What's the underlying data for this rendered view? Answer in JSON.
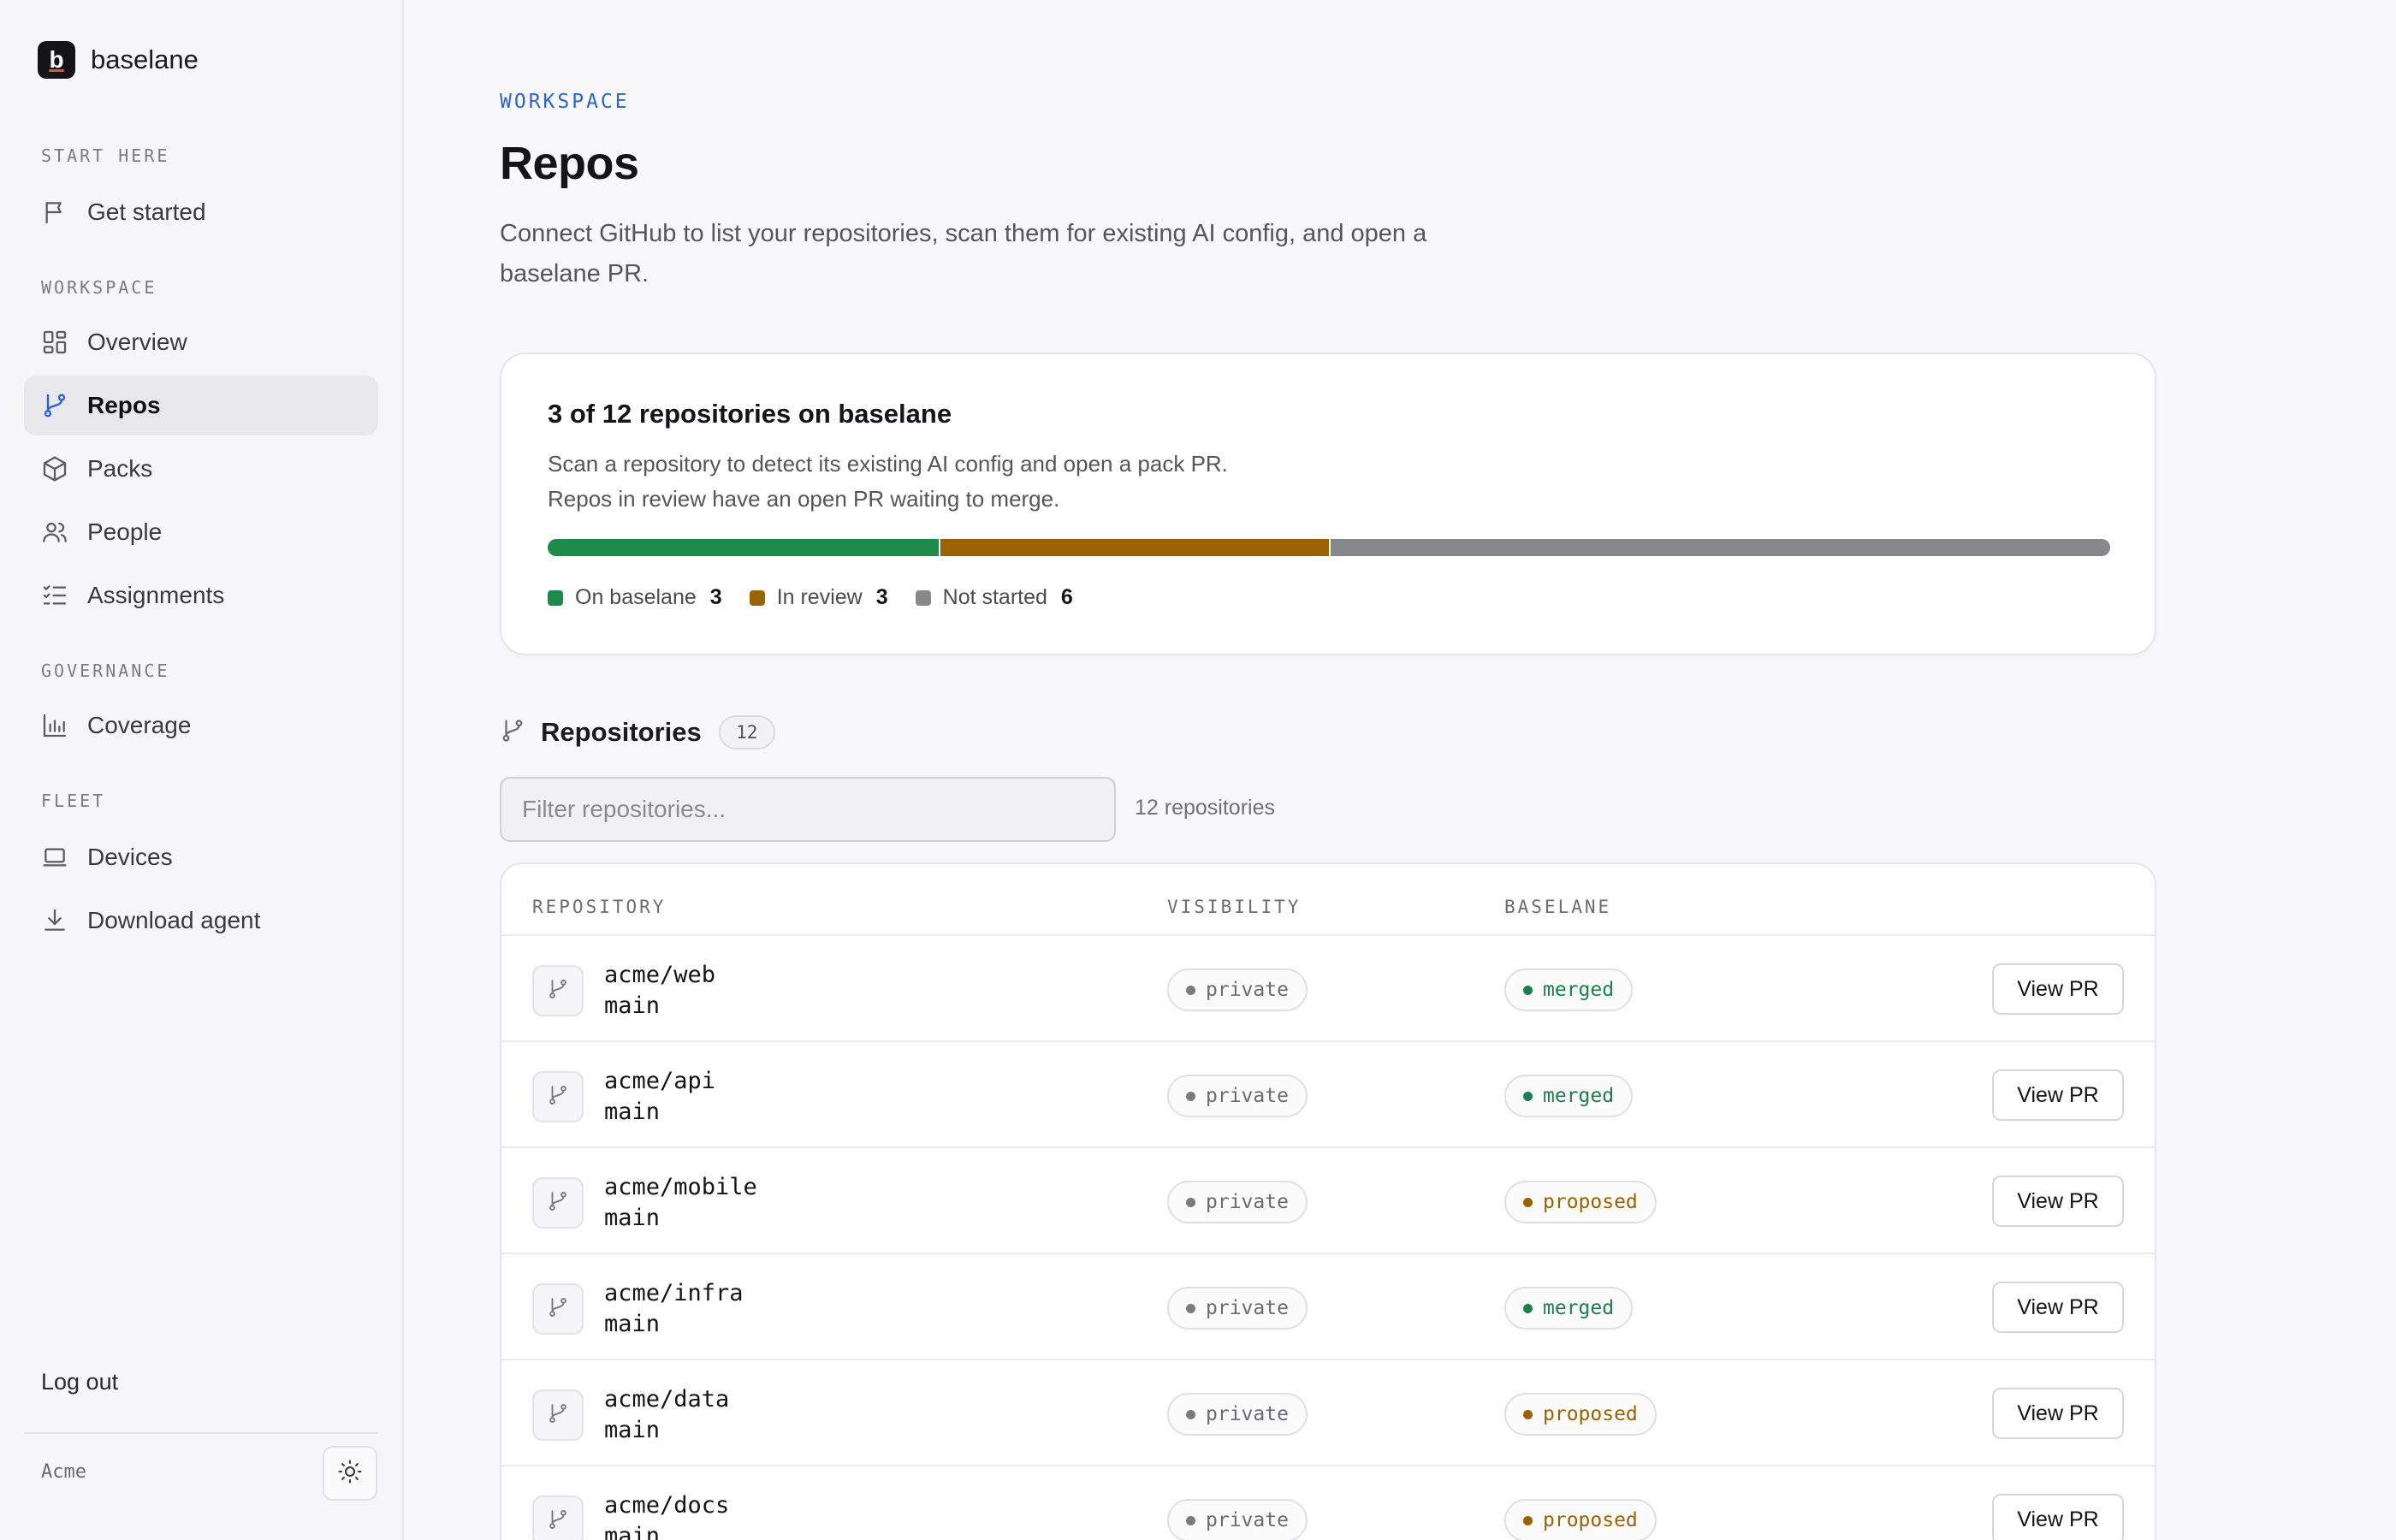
{
  "brand": {
    "logo_letter": "b",
    "name": "baselane"
  },
  "sidebar": {
    "sections": [
      {
        "label": "START HERE",
        "items": [
          {
            "label": "Get started",
            "icon": "flag-icon"
          }
        ]
      },
      {
        "label": "WORKSPACE",
        "items": [
          {
            "label": "Overview",
            "icon": "grid-icon"
          },
          {
            "label": "Repos",
            "icon": "git-branch-icon",
            "active": true
          },
          {
            "label": "Packs",
            "icon": "package-icon"
          },
          {
            "label": "People",
            "icon": "users-icon"
          },
          {
            "label": "Assignments",
            "icon": "list-checks-icon"
          }
        ]
      },
      {
        "label": "GOVERNANCE",
        "items": [
          {
            "label": "Coverage",
            "icon": "bar-chart-icon"
          }
        ]
      },
      {
        "label": "FLEET",
        "items": [
          {
            "label": "Devices",
            "icon": "laptop-icon"
          },
          {
            "label": "Download agent",
            "icon": "download-icon"
          }
        ]
      }
    ],
    "logout": "Log out",
    "org": "Acme",
    "theme_toggle_icon": "sun-icon"
  },
  "header": {
    "eyebrow": "WORKSPACE",
    "title": "Repos",
    "description": "Connect GitHub to list your repositories, scan them for existing AI config, and open a baselane PR."
  },
  "summary": {
    "title": "3 of 12 repositories on baselane",
    "line1": "Scan a repository to detect its existing AI config and open a pack PR.",
    "line2": "Repos in review have an open PR waiting to merge.",
    "segments": [
      {
        "label": "On baselane",
        "count": 3,
        "color": "#1e8a4c"
      },
      {
        "label": "In review",
        "count": 3,
        "color": "#9a6300"
      },
      {
        "label": "Not started",
        "count": 6,
        "color": "#87878c"
      }
    ]
  },
  "repositories": {
    "title": "Repositories",
    "count": "12",
    "filter_placeholder": "Filter repositories...",
    "filter_count": "12 repositories",
    "columns": [
      "REPOSITORY",
      "VISIBILITY",
      "BASELANE"
    ],
    "rows": [
      {
        "name": "acme/web",
        "branch": "main",
        "visibility": "private",
        "status": "merged",
        "action": "View PR"
      },
      {
        "name": "acme/api",
        "branch": "main",
        "visibility": "private",
        "status": "merged",
        "action": "View PR"
      },
      {
        "name": "acme/mobile",
        "branch": "main",
        "visibility": "private",
        "status": "proposed",
        "action": "View PR"
      },
      {
        "name": "acme/infra",
        "branch": "main",
        "visibility": "private",
        "status": "merged",
        "action": "View PR"
      },
      {
        "name": "acme/data",
        "branch": "main",
        "visibility": "private",
        "status": "proposed",
        "action": "View PR"
      },
      {
        "name": "acme/docs",
        "branch": "main",
        "visibility": "private",
        "status": "proposed",
        "action": "View PR"
      }
    ]
  }
}
